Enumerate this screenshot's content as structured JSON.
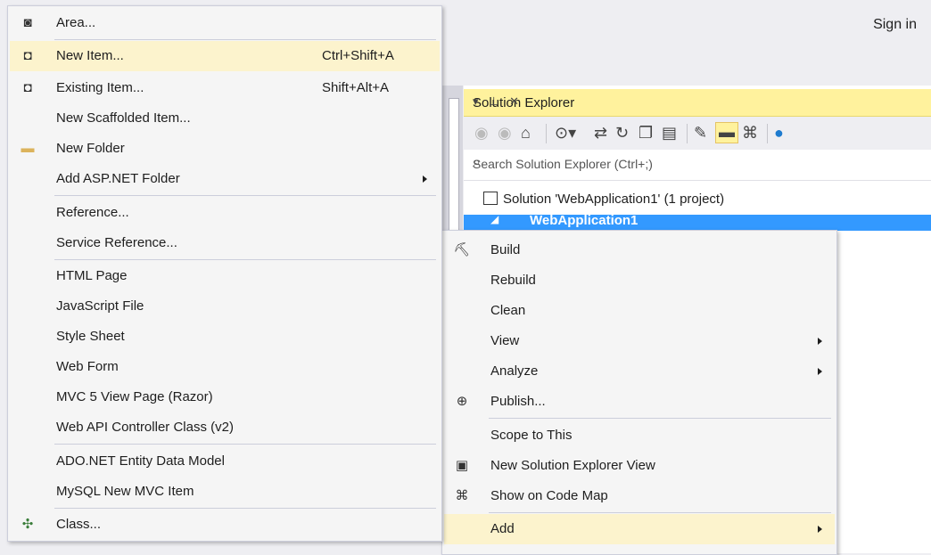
{
  "header": {
    "sign_in": "Sign in"
  },
  "solution_explorer": {
    "title": "Solution Explorer",
    "title_controls": "▾ ⊥ ✕",
    "search_placeholder": "Search Solution Explorer (Ctrl+;)",
    "search_icon": "search-icon",
    "solution_label": "Solution 'WebApplication1' (1 project)",
    "project_label": "WebApplication1"
  },
  "add_menu": {
    "items": [
      {
        "label": "Area...",
        "shortcut": "",
        "icon": "area-icon"
      },
      {
        "label": "New Item...",
        "shortcut": "Ctrl+Shift+A",
        "icon": "new-item-icon"
      },
      {
        "label": "Existing Item...",
        "shortcut": "Shift+Alt+A",
        "icon": "existing-item-icon"
      },
      {
        "label": "New Scaffolded Item...",
        "shortcut": ""
      },
      {
        "label": "New Folder",
        "shortcut": "",
        "icon": "folder-icon"
      },
      {
        "label": "Add ASP.NET Folder",
        "shortcut": "",
        "submenu": true
      },
      {
        "label": "Reference...",
        "shortcut": ""
      },
      {
        "label": "Service Reference...",
        "shortcut": ""
      },
      {
        "label": "HTML Page",
        "shortcut": ""
      },
      {
        "label": "JavaScript File",
        "shortcut": ""
      },
      {
        "label": "Style Sheet",
        "shortcut": ""
      },
      {
        "label": "Web Form",
        "shortcut": ""
      },
      {
        "label": "MVC 5 View Page (Razor)",
        "shortcut": ""
      },
      {
        "label": "Web API Controller Class (v2)",
        "shortcut": ""
      },
      {
        "label": "ADO.NET Entity Data Model",
        "shortcut": ""
      },
      {
        "label": "MySQL New MVC Item",
        "shortcut": ""
      },
      {
        "label": "Class...",
        "shortcut": "",
        "icon": "class-icon"
      }
    ]
  },
  "project_menu": {
    "items": [
      {
        "label": "Build",
        "icon": "build-icon"
      },
      {
        "label": "Rebuild"
      },
      {
        "label": "Clean"
      },
      {
        "label": "View",
        "submenu": true
      },
      {
        "label": "Analyze",
        "submenu": true
      },
      {
        "label": "Publish...",
        "icon": "publish-icon"
      },
      {
        "label": "Scope to This"
      },
      {
        "label": "New Solution Explorer View",
        "icon": "new-view-icon"
      },
      {
        "label": "Show on Code Map",
        "icon": "code-map-icon"
      },
      {
        "label": "Add",
        "submenu": true
      }
    ]
  },
  "colors": {
    "highlight": "#fcf3cd",
    "title_yellow": "#fff29d",
    "selection_blue": "#3399ff"
  }
}
